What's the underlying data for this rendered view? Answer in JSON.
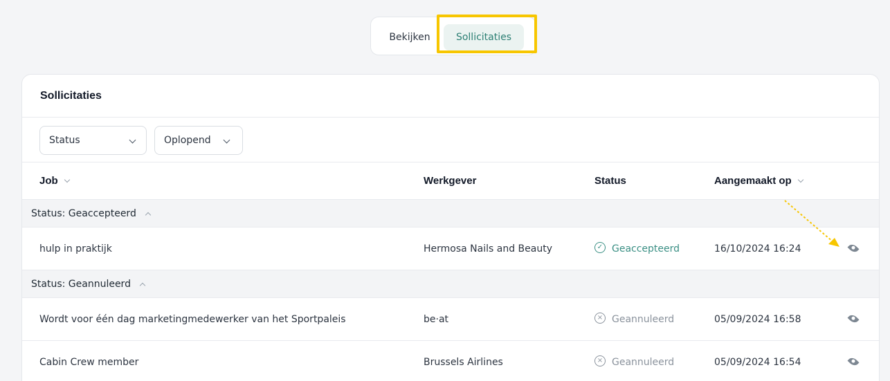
{
  "tabs": [
    {
      "label": "Bekijken",
      "active": false
    },
    {
      "label": "Sollicitaties",
      "active": true
    }
  ],
  "card": {
    "title": "Sollicitaties",
    "filters": {
      "status_label": "Status",
      "sort_label": "Oplopend"
    },
    "columns": {
      "job": "Job",
      "employer": "Werkgever",
      "status": "Status",
      "created": "Aangemaakt op"
    },
    "groups": [
      {
        "label": "Status: Geaccepteerd",
        "rows": [
          {
            "job": "hulp in praktijk",
            "employer": "Hermosa Nails and Beauty",
            "status": "Geaccepteerd",
            "date": "16/10/2024 16:24"
          }
        ]
      },
      {
        "label": "Status: Geannuleerd",
        "rows": [
          {
            "job": "Wordt voor één dag marketingmedewerker van het Sportpaleis",
            "employer": "be·at",
            "status": "Geannuleerd",
            "date": "05/09/2024 16:58"
          },
          {
            "job": "Cabin Crew member",
            "employer": "Brussels Airlines",
            "status": "Geannuleerd",
            "date": "05/09/2024 16:54"
          }
        ]
      }
    ]
  },
  "icons": {
    "accepted": "check-circle-icon",
    "cancelled": "x-circle-icon",
    "view": "eye-icon"
  },
  "colors": {
    "accent": "#2b7f73",
    "accepted": "#3a8f84",
    "cancelled": "#8a929c",
    "highlight": "#f7c600"
  }
}
